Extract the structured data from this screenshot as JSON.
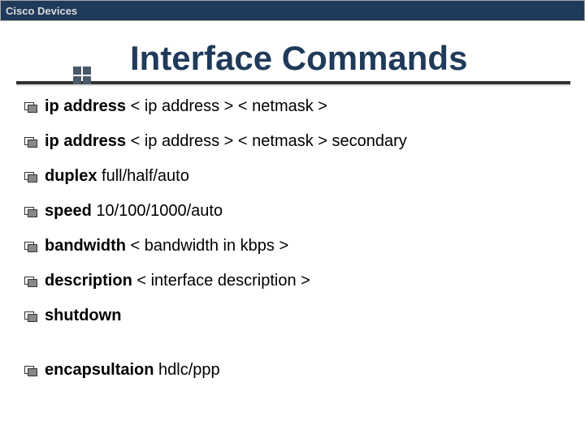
{
  "header": {
    "title": "Cisco Devices"
  },
  "slide": {
    "title": "Interface Commands"
  },
  "items": [
    {
      "cmd": "ip address",
      "args": " < ip address > < netmask >"
    },
    {
      "cmd": "ip address",
      "args": " < ip address > < netmask > secondary"
    },
    {
      "cmd": "duplex",
      "args": " full/half/auto"
    },
    {
      "cmd": "speed",
      "args": " 10/100/1000/auto"
    },
    {
      "cmd": "bandwidth",
      "args": " < bandwidth in kbps >"
    },
    {
      "cmd": "description",
      "args": " < interface description >"
    },
    {
      "cmd": "shutdown",
      "args": ""
    },
    {
      "cmd": "encapsultaion",
      "args": " hdlc/ppp"
    }
  ]
}
